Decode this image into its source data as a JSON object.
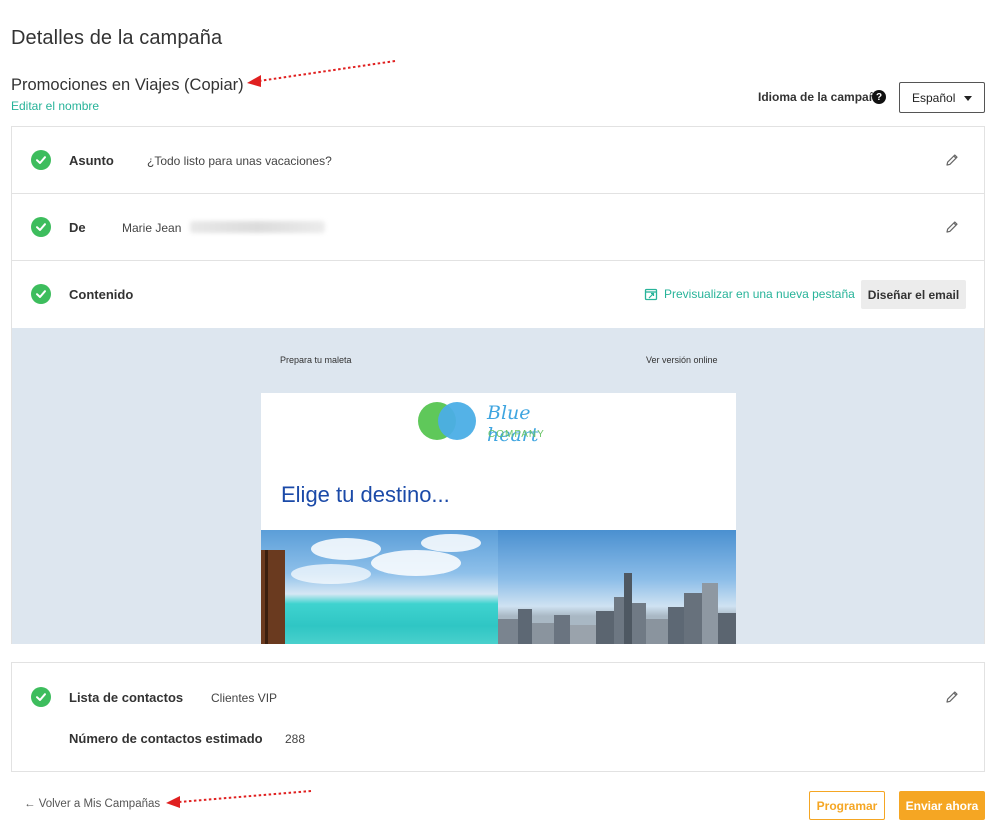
{
  "page": {
    "title": "Detalles de la campaña"
  },
  "campaign": {
    "name": "Promociones en Viajes (Copiar)",
    "edit_name_label": "Editar el nombre"
  },
  "language": {
    "label": "Idioma de la campaña",
    "help_symbol": "?",
    "selected": "Español"
  },
  "rows": {
    "subject": {
      "label": "Asunto",
      "value": "¿Todo listo para unas vacaciones?"
    },
    "from": {
      "label": "De",
      "name": "Marie Jean"
    },
    "content": {
      "label": "Contenido",
      "preview_label": "Previsualizar en una nueva pestaña",
      "design_label": "Diseñar el email"
    }
  },
  "email_preview": {
    "preheader": "Prepara tu maleta",
    "online_version": "Ver versión online",
    "logo_text": "Blue heart",
    "logo_sub": "COMPANY",
    "headline": "Elige tu destino..."
  },
  "contacts": {
    "list_label": "Lista de contactos",
    "list_value": "Clientes VIP",
    "estimate_label": "Número de contactos estimado",
    "estimate_value": "288"
  },
  "footer": {
    "back_label": "← Volver a Mis Campañas",
    "schedule_label": "Programar",
    "send_label": "Enviar ahora"
  },
  "colors": {
    "accent_green": "#27b399",
    "check_green": "#3dbd5d",
    "orange": "#f5a623",
    "annotation_red": "#e02020"
  }
}
